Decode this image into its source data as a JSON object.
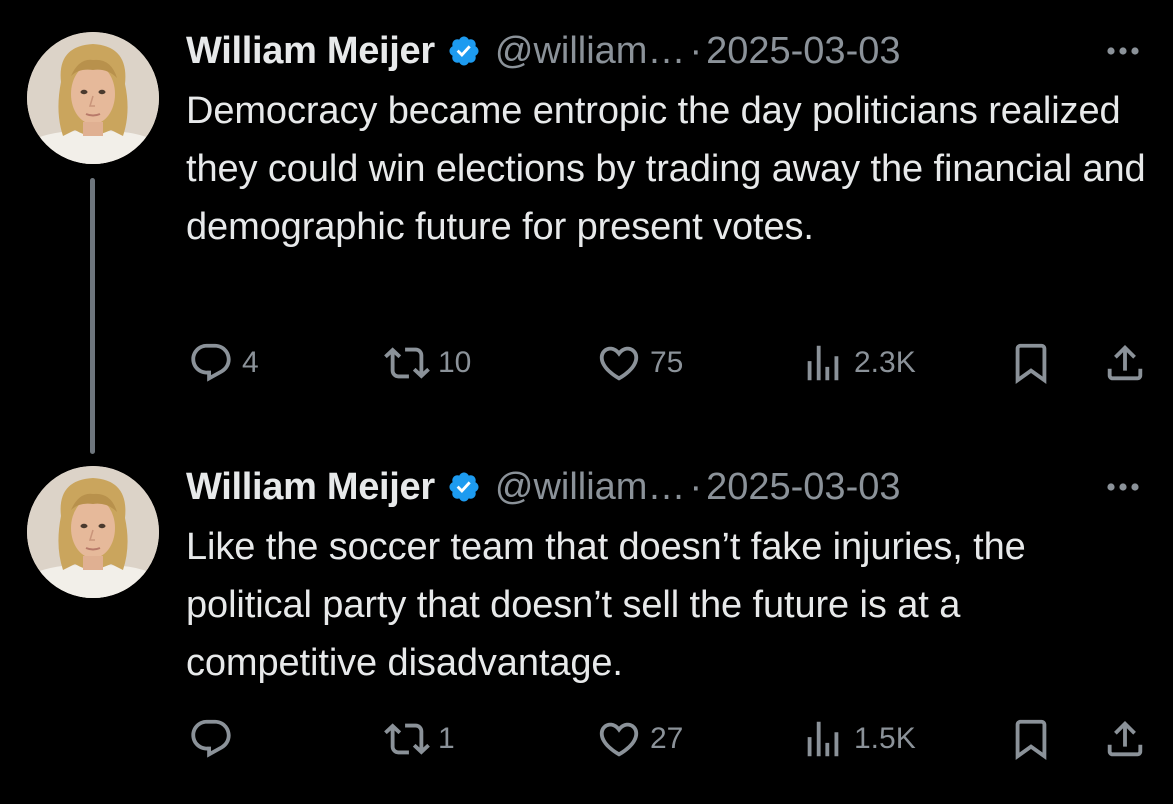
{
  "colors": {
    "background": "#000000",
    "primary_text": "#e7e9ea",
    "secondary_text": "#8b9299",
    "verified_badge": "#1d9bf0",
    "thread_line": "#6e767d"
  },
  "tweets": [
    {
      "author_name": "William Meijer",
      "handle": "@william…",
      "separator": "·",
      "date": "2025-03-03",
      "verified": true,
      "text": "Democracy became entropic the day politicians realized they could win elections by trading away the financial and demographic future for present votes.",
      "stats": {
        "replies": "4",
        "retweets": "10",
        "likes": "75",
        "views": "2.3K"
      }
    },
    {
      "author_name": "William Meijer",
      "handle": "@william…",
      "separator": "·",
      "date": "2025-03-03",
      "verified": true,
      "text": "Like the soccer team that doesn’t fake injuries, the political party that doesn’t sell the future is at a competitive disadvantage.",
      "stats": {
        "replies": "",
        "retweets": "1",
        "likes": "27",
        "views": "1.5K"
      }
    }
  ],
  "icons": {
    "reply": "reply-bubble-icon",
    "retweet": "retweet-arrows-icon",
    "like": "heart-icon",
    "views": "bar-chart-icon",
    "bookmark": "bookmark-icon",
    "share": "share-upload-icon",
    "more": "more-dots-icon",
    "verified": "verified-badge-icon"
  }
}
